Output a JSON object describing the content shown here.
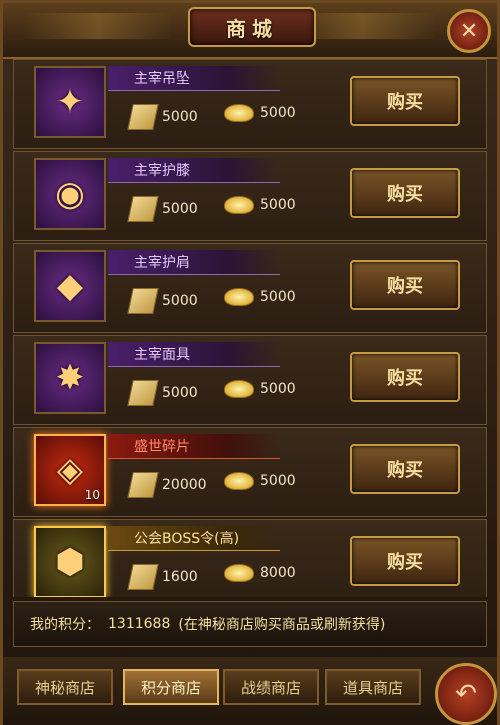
{
  "window": {
    "title": "商城"
  },
  "close_icon": "✕",
  "items": [
    {
      "name": "主宰吊坠",
      "glyph": "✦",
      "price_scroll": "5000",
      "price_gold": "5000",
      "buy_label": "购买"
    },
    {
      "name": "主宰护膝",
      "glyph": "◉",
      "price_scroll": "5000",
      "price_gold": "5000",
      "buy_label": "购买"
    },
    {
      "name": "主宰护肩",
      "glyph": "◆",
      "price_scroll": "5000",
      "price_gold": "5000",
      "buy_label": "购买"
    },
    {
      "name": "主宰面具",
      "glyph": "✸",
      "price_scroll": "5000",
      "price_gold": "5000",
      "buy_label": "购买"
    },
    {
      "name": "盛世碎片",
      "glyph": "◈",
      "count": "10",
      "price_scroll": "20000",
      "price_gold": "5000",
      "buy_label": "购买"
    },
    {
      "name": "公会BOSS令(高)",
      "glyph": "⬢",
      "price_scroll": "1600",
      "price_gold": "8000",
      "buy_label": "购买"
    }
  ],
  "points": {
    "label": "我的积分：",
    "value": "1311688",
    "hint": "(在神秘商店购买商品或刷新获得)"
  },
  "tabs": [
    {
      "label": "神秘商店"
    },
    {
      "label": "积分商店"
    },
    {
      "label": "战绩商店"
    },
    {
      "label": "道具商店"
    }
  ],
  "back_icon": "↶",
  "colors": {
    "accent": "#c69a45",
    "text": "#f6dfa0",
    "active_tab": "#a07235"
  }
}
